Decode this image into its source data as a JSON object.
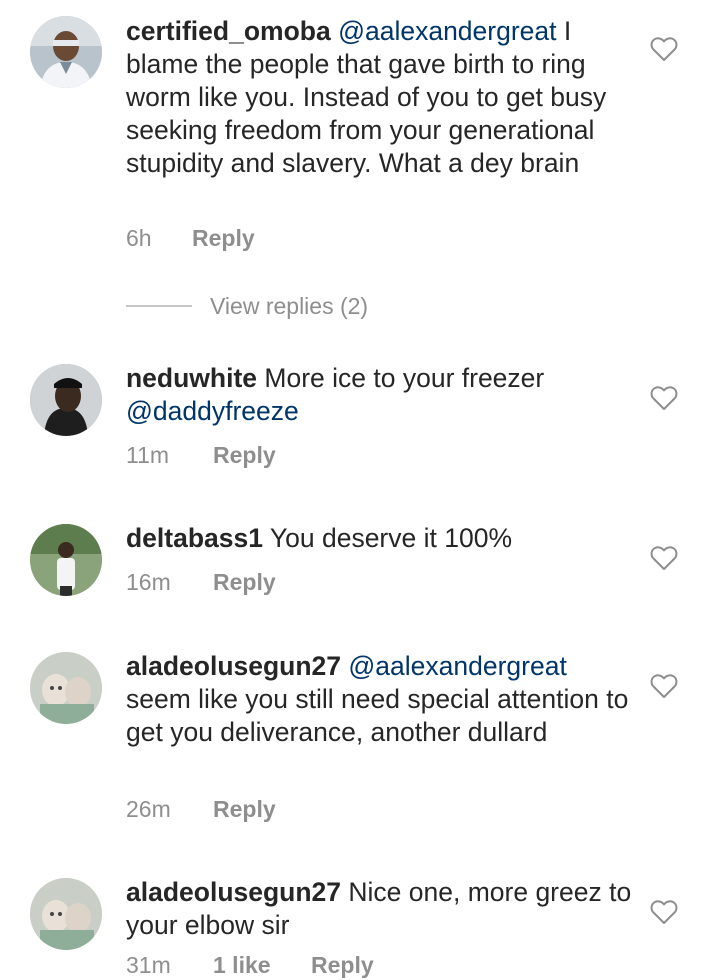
{
  "comments": [
    {
      "username": "certified_omoba",
      "mention": "@aalexandergreat",
      "text": "I blame the people that gave birth to ring worm like you. Instead of you to get busy seeking freedom from your generational stupidity and slavery. What a dey brain",
      "time": "6h",
      "reply_label": "Reply",
      "heart_icon": "heart-outline-icon"
    },
    {
      "username": "neduwhite",
      "text": "More ice to your freezer",
      "mention_after": "@daddyfreeze",
      "time": "11m",
      "reply_label": "Reply",
      "heart_icon": "heart-outline-icon"
    },
    {
      "username": "deltabass1",
      "text": "You deserve it 100%",
      "time": "16m",
      "reply_label": "Reply",
      "heart_icon": "heart-outline-icon"
    },
    {
      "username": "aladeolusegun27",
      "mention": "@aalexandergreat",
      "text": "seem like you still need special attention to get you deliverance, another dullard",
      "time": "26m",
      "reply_label": "Reply",
      "heart_icon": "heart-outline-icon"
    },
    {
      "username": "aladeolusegun27",
      "text": "Nice one, more greez to your elbow sir",
      "time": "31m",
      "likes": "1 like",
      "reply_label": "Reply",
      "heart_icon": "heart-outline-icon"
    }
  ],
  "view_replies": "View replies (2)",
  "colors": {
    "text": "#262626",
    "mention": "#003569",
    "meta": "#8e8e8e"
  }
}
